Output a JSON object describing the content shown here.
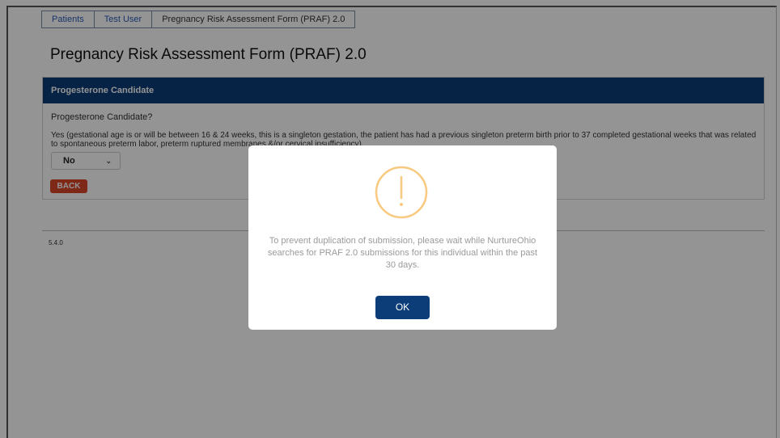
{
  "breadcrumb": {
    "items": [
      "Patients",
      "Test User",
      "Pregnancy Risk Assessment Form (PRAF) 2.0"
    ]
  },
  "page": {
    "title": "Pregnancy Risk Assessment Form (PRAF) 2.0"
  },
  "panel": {
    "header": "Progesterone Candidate",
    "question": "Progesterone Candidate?",
    "description": "Yes (gestational age is or will be between 16 & 24 weeks, this is a singleton gestation, the patient has had a previous singleton preterm birth prior to 37 completed gestational weeks that was related to spontaneous preterm labor, preterm ruptured membranes &/or cervical insufficiency)",
    "select_value": "No",
    "back_label": "BACK"
  },
  "footer": {
    "version": "5.4.0"
  },
  "modal": {
    "icon": "exclamation-icon",
    "message": "To prevent duplication of submission, please wait while NurtureOhio searches for PRAF 2.0 submissions for this individual within the past 30 days.",
    "ok_label": "OK"
  },
  "colors": {
    "primary": "#0c3d79",
    "back_button": "#d9462a",
    "warning": "#f8c97f",
    "link": "#2a5bb5"
  }
}
